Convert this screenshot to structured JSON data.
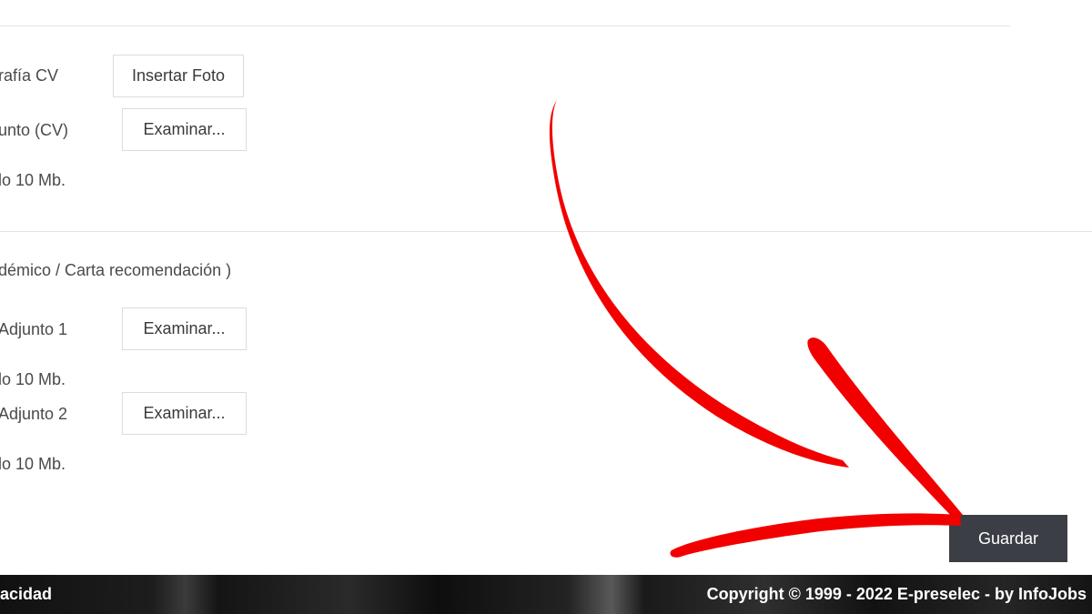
{
  "photo_section": {
    "photo_label": "rafía CV",
    "photo_button": "Insertar Foto",
    "attachment_label": "unto (CV)",
    "attachment_button": "Examinar...",
    "attachment_note": "lo 10 Mb."
  },
  "extra_section": {
    "heading": "démico / Carta recomendación )",
    "attachments": [
      {
        "label": "Adjunto 1",
        "button": "Examinar...",
        "note": "lo 10 Mb."
      },
      {
        "label": "Adjunto 2",
        "button": "Examinar...",
        "note": "lo 10 Mb."
      }
    ]
  },
  "actions": {
    "save_label": "Guardar"
  },
  "footer": {
    "left_text": "acidad",
    "copyright": "Copyright © 1999 - 2022 E-preselec - by InfoJobs"
  },
  "annotation": {
    "arrow_color": "#f20000"
  }
}
